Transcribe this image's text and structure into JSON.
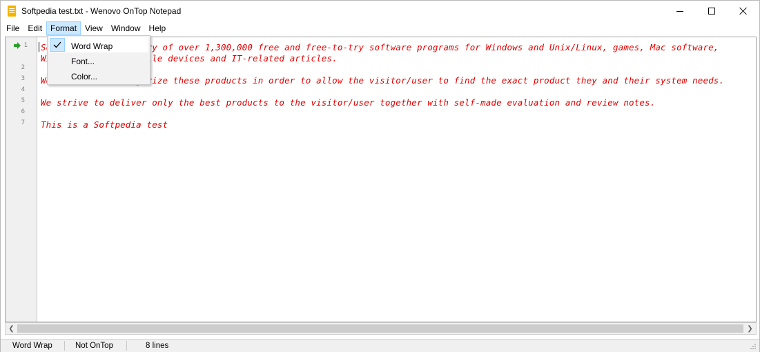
{
  "window": {
    "title": "Softpedia test.txt - Wenovo OnTop Notepad",
    "icon": "notepad-app-icon"
  },
  "menubar": {
    "items": [
      {
        "label": "File"
      },
      {
        "label": "Edit"
      },
      {
        "label": "Format"
      },
      {
        "label": "View"
      },
      {
        "label": "Window"
      },
      {
        "label": "Help"
      }
    ],
    "active": "Format"
  },
  "format_menu": {
    "items": [
      {
        "label": "Word Wrap",
        "checked": true
      },
      {
        "label": "Font..."
      },
      {
        "label": "Color..."
      }
    ]
  },
  "editor": {
    "text_color": "#e00000",
    "gutter_numbers": [
      "1",
      "2",
      "3",
      "4",
      "5",
      "6",
      "7"
    ],
    "lines": [
      "Softpedia is a library of over 1,300,000 free and free-to-try software programs for Windows and Unix/Linux, games, Mac software,",
      "Windows drivers, mobile devices and IT-related articles.",
      "We review and categorize these products in order to allow the visitor/user to find the exact product they and their system needs.",
      "We strive to deliver only the best products to the visitor/user together with self-made evaluation and review notes.",
      "This is a Softpedia test"
    ]
  },
  "statusbar": {
    "word_wrap": "Word Wrap",
    "on_top": "Not OnTop",
    "line_count": "8 lines"
  }
}
